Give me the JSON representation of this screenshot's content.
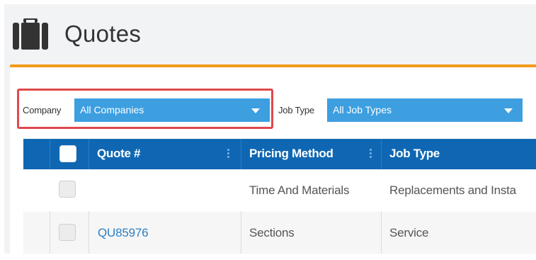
{
  "page": {
    "title": "Quotes",
    "icon": "briefcase-icon",
    "accent_color": "#f39b1a",
    "grid_header_color": "#0f67b3",
    "select_color": "#3d9fe0",
    "highlight_color": "#e0484b"
  },
  "filters": {
    "company": {
      "label": "Company",
      "value": "All Companies"
    },
    "job_type": {
      "label": "Job Type",
      "value": "All Job Types"
    }
  },
  "grid": {
    "columns": [
      "Quote #",
      "Pricing Method",
      "Job Type"
    ],
    "rows": [
      {
        "quote": "",
        "pricing_method": "Time And Materials",
        "job_type": "Replacements and Insta"
      },
      {
        "quote": "QU85976",
        "pricing_method": "Sections",
        "job_type": "Service"
      }
    ]
  }
}
